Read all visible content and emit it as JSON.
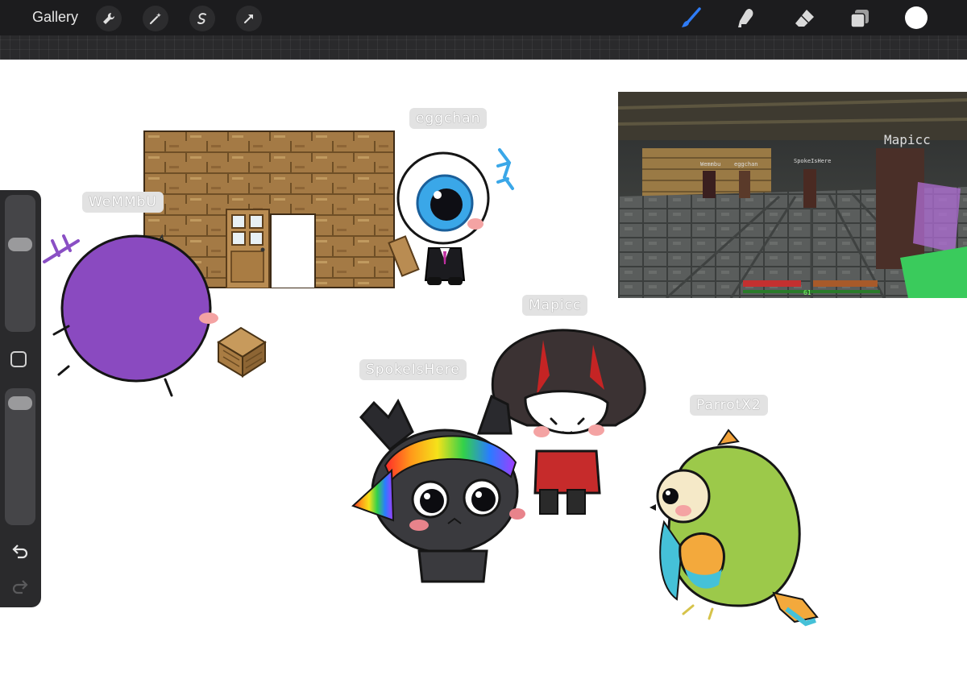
{
  "toolbar": {
    "gallery_label": "Gallery",
    "left_tools": [
      "wrench-icon",
      "magic-wand-icon",
      "selection-icon",
      "transform-arrow-icon"
    ],
    "right_tools": [
      "brush-icon",
      "smudge-icon",
      "eraser-icon",
      "layers-icon",
      "color-icon"
    ],
    "accent_color": "#2f7cf6",
    "current_color": "#ffffff"
  },
  "sidebar": {
    "brush_size_level": 0.34,
    "opacity_level": 0.04
  },
  "canvas": {
    "tags": {
      "wemmbu": "WeMMbU",
      "eggchan": "eggchan",
      "mapicc": "Mapicc",
      "spokeishere": "SpokeIsHere",
      "parrotx2": "ParrotX2"
    },
    "screenshot": {
      "nametag_mapicc": "Mapicc",
      "nametag_wemmbu": "Wemmbu",
      "nametag_eggchan": "eggchan",
      "nametag_spoke": "SpokeIsHere",
      "xp_level": "61"
    }
  }
}
